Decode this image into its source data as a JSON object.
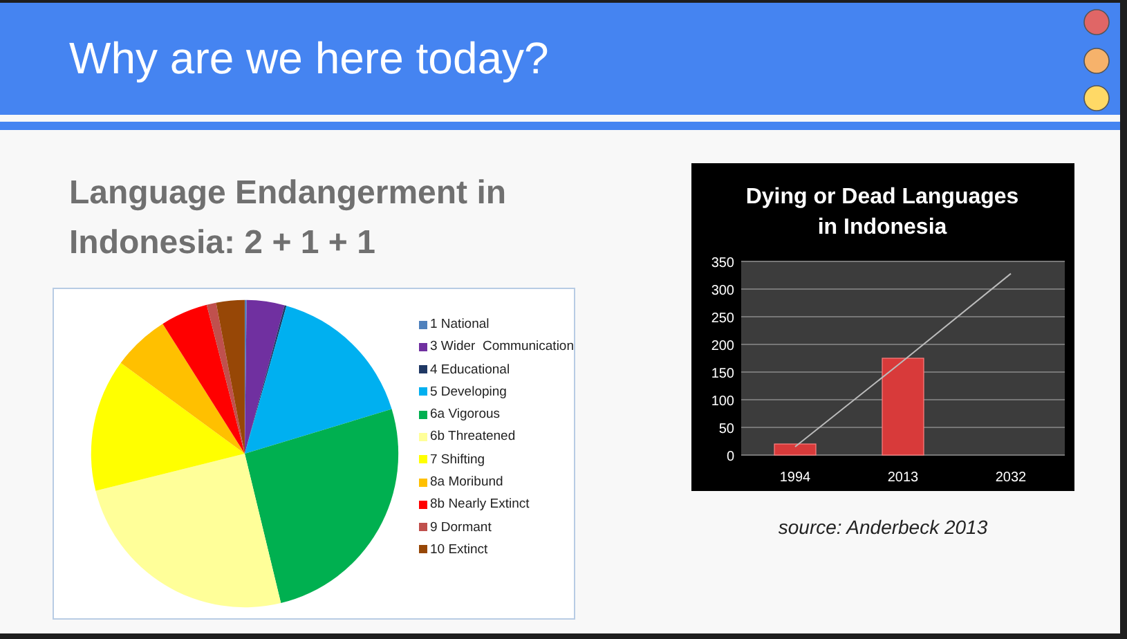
{
  "slide": {
    "title": "Why are we here today?",
    "heading": "Language Endangerment in Indonesia: 2 + 1 + 1",
    "caption": "source: Anderbeck 2013"
  },
  "pie": {
    "chart_data": {
      "type": "pie",
      "legend": "right",
      "categories": [
        "1 National",
        "3 Wider  Communication",
        "4 Educational",
        "5 Developing",
        "6a Vigorous",
        "6b Threatened",
        "7 Shifting",
        "8a Moribund",
        "8b Nearly Extinct",
        "9 Dormant",
        "10 Extinct"
      ],
      "values": [
        0.2,
        4,
        0.2,
        16,
        26,
        25,
        14,
        6,
        5,
        1,
        3
      ],
      "colors": [
        "#4f81bd",
        "#7030a0",
        "#1f3864",
        "#00b0f0",
        "#00b050",
        "#ffff99",
        "#ffff00",
        "#ffc000",
        "#ff0000",
        "#c0504d",
        "#974706"
      ]
    }
  },
  "bar": {
    "chart_data": {
      "type": "bar",
      "title": "Dying or Dead Languages in Indonesia",
      "categories": [
        "1994",
        "2013",
        "2032"
      ],
      "grid": true,
      "series": [
        {
          "color": "#d83a3a",
          "values": [
            20,
            175,
            null
          ]
        },
        {
          "type": "line",
          "color": "#bbbbbb",
          "values": [
            15,
            170,
            328
          ]
        }
      ],
      "ylim": [
        0,
        350
      ],
      "yticks": [
        0,
        50,
        100,
        150,
        200,
        250,
        300,
        350
      ]
    }
  }
}
